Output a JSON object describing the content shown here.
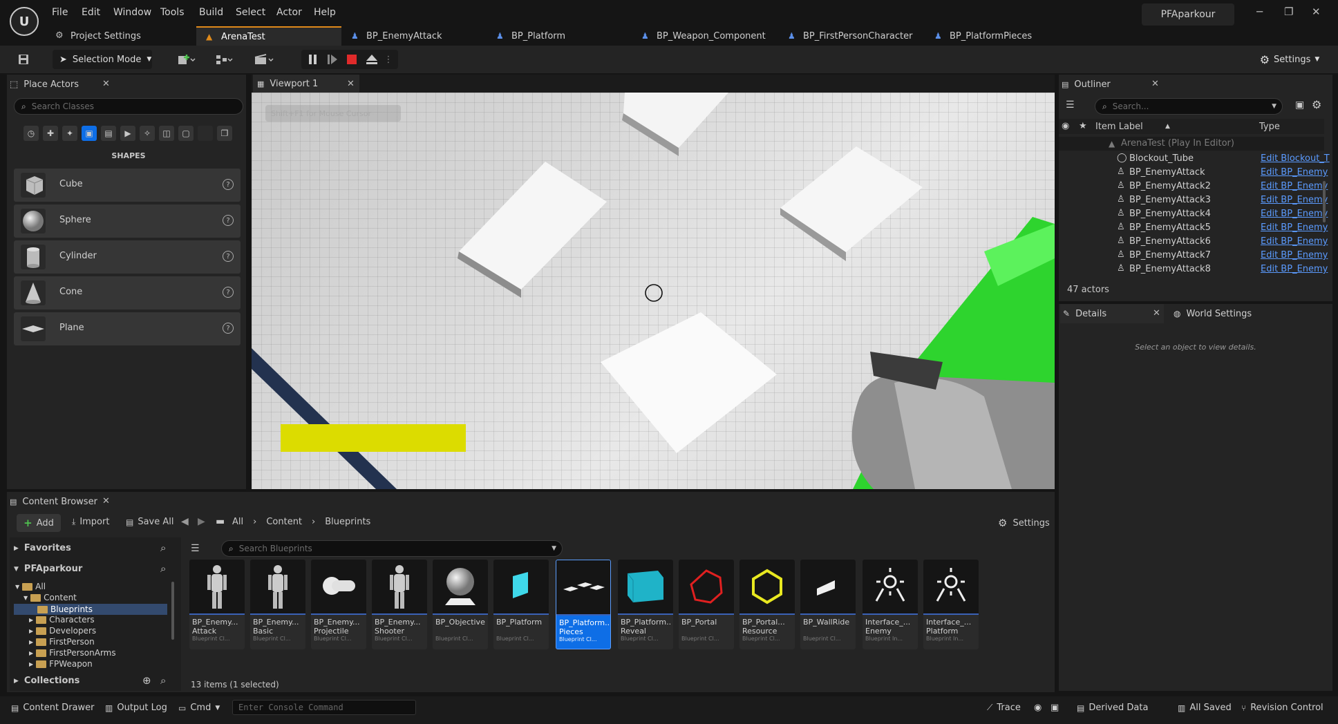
{
  "menu": {
    "items": [
      "File",
      "Edit",
      "Window",
      "Tools",
      "Build",
      "Select",
      "Actor",
      "Help"
    ],
    "project_title": "PFAparkour"
  },
  "doc_tabs": [
    {
      "label": "Project Settings",
      "icon": "settings-icon",
      "active": false
    },
    {
      "label": "ArenaTest",
      "icon": "level-icon",
      "active": true
    },
    {
      "label": "BP_EnemyAttack",
      "icon": "blueprint-icon",
      "active": false
    },
    {
      "label": "BP_Platform",
      "icon": "blueprint-icon",
      "active": false
    },
    {
      "label": "BP_Weapon_Component",
      "icon": "blueprint-icon",
      "active": false
    },
    {
      "label": "BP_FirstPersonCharacter",
      "icon": "blueprint-icon",
      "active": false
    },
    {
      "label": "BP_PlatformPieces",
      "icon": "blueprint-icon",
      "active": false
    }
  ],
  "toolbar": {
    "selection_mode": "Selection Mode",
    "settings_label": "Settings"
  },
  "place_actors": {
    "title": "Place Actors",
    "search_placeholder": "Search Classes",
    "section": "SHAPES",
    "shapes": [
      "Cube",
      "Sphere",
      "Cylinder",
      "Cone",
      "Plane"
    ]
  },
  "viewport": {
    "tab_label": "Viewport 1",
    "hint": "Shift+F1 for Mouse Cursor"
  },
  "outliner": {
    "title": "Outliner",
    "search_placeholder": "Search...",
    "col_label": "Item Label",
    "col_type": "Type",
    "root": "ArenaTest (Play In Editor)",
    "items": [
      {
        "label": "Blockout_Tube",
        "type": "Edit Blockout_T"
      },
      {
        "label": "BP_EnemyAttack",
        "type": "Edit BP_Enemy"
      },
      {
        "label": "BP_EnemyAttack2",
        "type": "Edit BP_Enemy"
      },
      {
        "label": "BP_EnemyAttack3",
        "type": "Edit BP_Enemy"
      },
      {
        "label": "BP_EnemyAttack4",
        "type": "Edit BP_Enemy"
      },
      {
        "label": "BP_EnemyAttack5",
        "type": "Edit BP_Enemy"
      },
      {
        "label": "BP_EnemyAttack6",
        "type": "Edit BP_Enemy"
      },
      {
        "label": "BP_EnemyAttack7",
        "type": "Edit BP_Enemy"
      },
      {
        "label": "BP_EnemyAttack8",
        "type": "Edit BP_Enemy"
      }
    ],
    "count": "47 actors"
  },
  "details": {
    "tab_details": "Details",
    "tab_world": "World Settings",
    "empty_hint": "Select an object to view details."
  },
  "content_browser": {
    "title": "Content Browser",
    "add": "Add",
    "import": "Import",
    "save_all": "Save All",
    "path": [
      "All",
      "Content",
      "Blueprints"
    ],
    "settings": "Settings",
    "favorites": "Favorites",
    "project": "PFAparkour",
    "collections": "Collections",
    "search_placeholder": "Search Blueprints",
    "tree": [
      "All",
      "Content",
      "Blueprints",
      "Characters",
      "Developers",
      "FirstPerson",
      "FirstPersonArms",
      "FPWeapon"
    ],
    "status": "13 items (1 selected)",
    "assets": [
      {
        "name": "BP_Enemy...",
        "name2": "Attack",
        "type": "Blueprint Cl..."
      },
      {
        "name": "BP_Enemy...",
        "name2": "Basic",
        "type": "Blueprint Cl..."
      },
      {
        "name": "BP_Enemy...",
        "name2": "Projectile",
        "type": "Blueprint Cl..."
      },
      {
        "name": "BP_Enemy...",
        "name2": "Shooter",
        "type": "Blueprint Cl..."
      },
      {
        "name": "BP_Objective",
        "name2": "",
        "type": "Blueprint Cl..."
      },
      {
        "name": "BP_Platform",
        "name2": "",
        "type": "Blueprint Cl..."
      },
      {
        "name": "BP_Platform...",
        "name2": "Pieces",
        "type": "Blueprint Cl..."
      },
      {
        "name": "BP_Platform...",
        "name2": "Reveal",
        "type": "Blueprint Cl..."
      },
      {
        "name": "BP_Portal",
        "name2": "",
        "type": "Blueprint Cl..."
      },
      {
        "name": "BP_Portal...",
        "name2": "Resource",
        "type": "Blueprint Cl..."
      },
      {
        "name": "BP_WallRide",
        "name2": "",
        "type": "Blueprint Cl..."
      },
      {
        "name": "Interface_...",
        "name2": "Enemy",
        "type": "Blueprint In..."
      },
      {
        "name": "Interface_...",
        "name2": "Platform",
        "type": "Blueprint In..."
      }
    ]
  },
  "statusbar": {
    "content_drawer": "Content Drawer",
    "output_log": "Output Log",
    "cmd": "Cmd",
    "console_placeholder": "Enter Console Command",
    "trace": "Trace",
    "derived_data": "Derived Data",
    "all_saved": "All Saved",
    "revision": "Revision Control"
  },
  "colors": {
    "accent_tab": "#e08a1a",
    "selected_blue": "#0e6ee6",
    "link_blue": "#5b9bff",
    "stop_red": "#e02a2a",
    "add_green": "#4fc24f"
  }
}
